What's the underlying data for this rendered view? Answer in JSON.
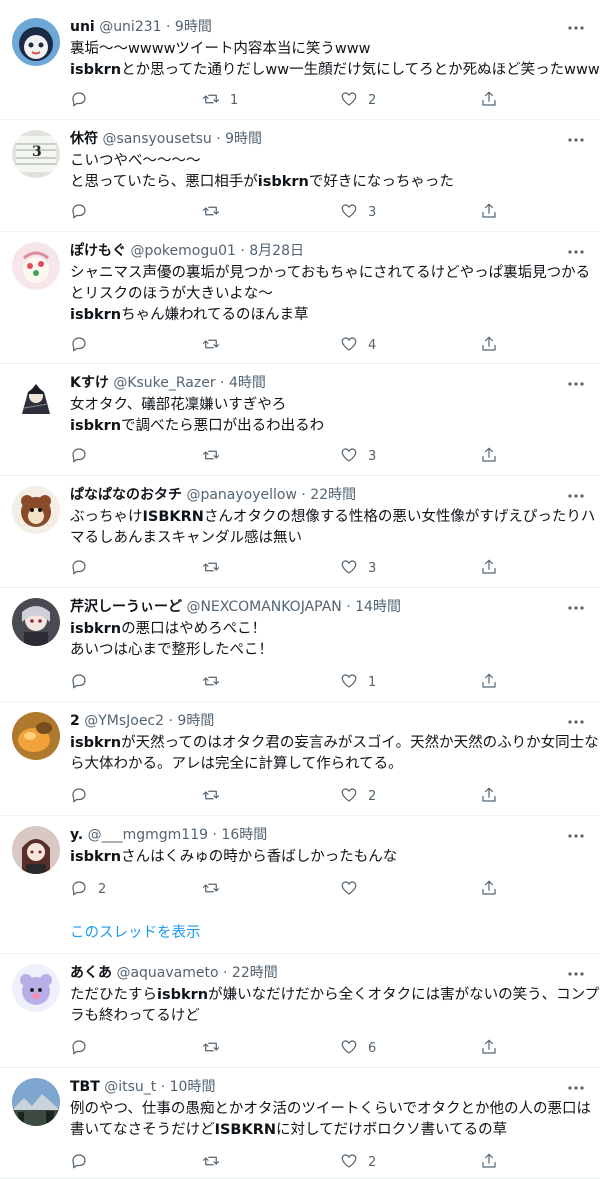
{
  "ui": {
    "more_icon": "more-horizontal-icon",
    "accent": "#1d9bf0",
    "muted": "#536471"
  },
  "tweets": [
    {
      "name": "uni",
      "handle": "@uni231",
      "time": "9時間",
      "lines": [
        [
          {
            "t": "裏垢〜〜wwwwツイート内容本当に笑うwww"
          }
        ],
        [
          {
            "t": "isbkrn",
            "b": true
          },
          {
            "t": "とか思ってた通りだしww一生顔だけ気にしてろとか死ぬほど笑ったwwwww"
          }
        ]
      ],
      "reply_count": "",
      "retweet_count": "1",
      "like_count": "2"
    },
    {
      "name": "休符",
      "handle": "@sansyousetsu",
      "time": "9時間",
      "lines": [
        [
          {
            "t": "こいつやべ〜〜〜〜"
          }
        ],
        [
          {
            "t": "と思っていたら、悪口相手が"
          },
          {
            "t": "isbkrn",
            "b": true
          },
          {
            "t": "で好きになっちゃった"
          }
        ]
      ],
      "reply_count": "",
      "retweet_count": "",
      "like_count": "3"
    },
    {
      "name": "ぽけもぐ",
      "handle": "@pokemogu01",
      "time": "8月28日",
      "lines": [
        [
          {
            "t": "シャニマス声優の裏垢が見つかっておもちゃにされてるけどやっぱ裏垢見つかる"
          }
        ],
        [
          {
            "t": "とリスクのほうが大きいよな〜"
          }
        ],
        [
          {
            "t": "isbkrn",
            "b": true
          },
          {
            "t": "ちゃん嫌われてるのほんま草"
          }
        ]
      ],
      "reply_count": "",
      "retweet_count": "",
      "like_count": "4"
    },
    {
      "name": "Kすけ",
      "handle": "@Ksuke_Razer",
      "time": "4時間",
      "lines": [
        [
          {
            "t": "女オタク、礒部花凜嫌いすぎやろ"
          }
        ],
        [
          {
            "t": "isbkrn",
            "b": true
          },
          {
            "t": "で調べたら悪口が出るわ出るわ"
          }
        ]
      ],
      "reply_count": "",
      "retweet_count": "",
      "like_count": "3"
    },
    {
      "name": "ぱなぱなのおタチ",
      "handle": "@panayoyellow",
      "time": "22時間",
      "lines": [
        [
          {
            "t": "ぶっちゃけ"
          },
          {
            "t": "ISBKRN",
            "b": true
          },
          {
            "t": "さんオタクの想像する性格の悪い女性像がすげえぴったりハ"
          }
        ],
        [
          {
            "t": "マるしあんまスキャンダル感は無い"
          }
        ]
      ],
      "reply_count": "",
      "retweet_count": "",
      "like_count": "3"
    },
    {
      "name": "芹沢しーうぃーど",
      "handle": "@NEXCOMANKOJAPAN",
      "time": "14時間",
      "lines": [
        [
          {
            "t": "isbkrn",
            "b": true
          },
          {
            "t": "の悪口はやめろぺこ！"
          }
        ],
        [
          {
            "t": "あいつは心まで整形したぺこ！"
          }
        ]
      ],
      "reply_count": "",
      "retweet_count": "",
      "like_count": "1"
    },
    {
      "name": "2",
      "handle": "@YMsJoec2",
      "time": "9時間",
      "lines": [
        [
          {
            "t": "isbkrn",
            "b": true
          },
          {
            "t": "が天然ってのはオタク君の妄言みがスゴイ。天然か天然のふりか女同士な"
          }
        ],
        [
          {
            "t": "ら大体わかる。アレは完全に計算して作られてる。"
          }
        ]
      ],
      "reply_count": "",
      "retweet_count": "",
      "like_count": "2"
    },
    {
      "name": "y.",
      "handle": "@___mgmgm119",
      "time": "16時間",
      "lines": [
        [
          {
            "t": "isbkrn",
            "b": true
          },
          {
            "t": "さんはくみゅの時から香ばしかったもんな"
          }
        ]
      ],
      "reply_count": "2",
      "retweet_count": "",
      "like_count": ""
    },
    {
      "name": "あくあ",
      "handle": "@aquavameto",
      "time": "22時間",
      "lines": [
        [
          {
            "t": "ただひたすら"
          },
          {
            "t": "isbkrn",
            "b": true
          },
          {
            "t": "が嫌いなだけだから全くオタクには害がないの笑う、コンプ"
          }
        ],
        [
          {
            "t": "ラも終わってるけど"
          }
        ]
      ],
      "reply_count": "",
      "retweet_count": "",
      "like_count": "6"
    },
    {
      "name": "TBT",
      "handle": "@itsu_t",
      "time": "10時間",
      "lines": [
        [
          {
            "t": "例のやつ、仕事の愚痴とかオタ活のツイートくらいでオタクとか他の人の悪口は"
          }
        ],
        [
          {
            "t": "書いてなさそうだけど"
          },
          {
            "t": "ISBKRN",
            "b": true
          },
          {
            "t": "に対してだけボロクソ書いてるの草"
          }
        ]
      ],
      "reply_count": "",
      "retweet_count": "",
      "like_count": "2"
    }
  ],
  "thread_link": "このスレッドを表示"
}
